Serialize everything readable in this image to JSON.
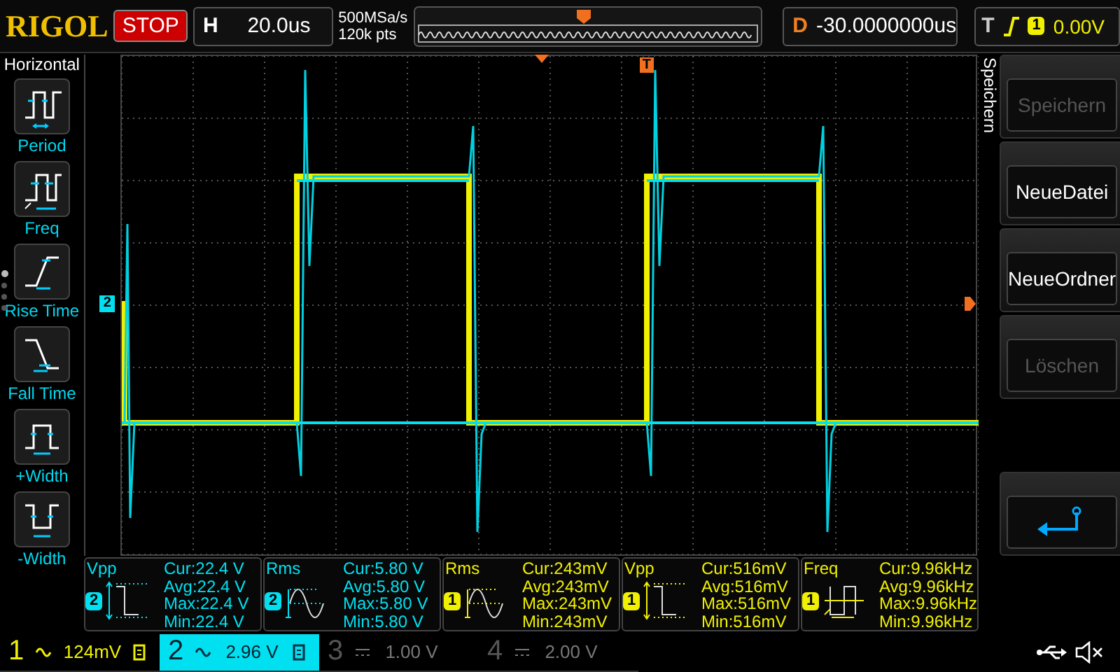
{
  "top_bar": {
    "brand": "RIGOL",
    "run_state": "STOP",
    "horizontal": {
      "label": "H",
      "value": "20.0us"
    },
    "sample_rate": "500MSa/s",
    "points": "120k pts",
    "delay": {
      "label": "D",
      "value": "-30.0000000us"
    },
    "trigger": {
      "label": "T",
      "source": "1",
      "level": "0.00V"
    }
  },
  "left_menu": {
    "title": "Horizontal",
    "items": [
      {
        "label": "Period",
        "kind": "period"
      },
      {
        "label": "Freq",
        "kind": "freq"
      },
      {
        "label": "Rise Time",
        "kind": "rise"
      },
      {
        "label": "Fall Time",
        "kind": "fall"
      },
      {
        "label": "+Width",
        "kind": "pwidth"
      },
      {
        "label": "-Width",
        "kind": "nwidth"
      }
    ],
    "pages": [
      {
        "selected": true
      },
      {
        "selected": false
      },
      {
        "selected": false
      },
      {
        "selected": false
      }
    ]
  },
  "display": {
    "channel_marker": "2",
    "trigger_marker": "T"
  },
  "measurements": [
    {
      "name": "Vpp",
      "channel": "2",
      "kind": "pulse",
      "lines": [
        "Cur:22.4 V",
        "Avg:22.4 V",
        "Max:22.4 V",
        "Min:22.4 V"
      ]
    },
    {
      "name": "Rms",
      "channel": "2",
      "kind": "sine",
      "lines": [
        "Cur:5.80 V",
        "Avg:5.80 V",
        "Max:5.80 V",
        "Min:5.80 V"
      ]
    },
    {
      "name": "Rms",
      "channel": "1",
      "kind": "sine",
      "lines": [
        "Cur:243mV",
        "Avg:243mV",
        "Max:243mV",
        "Min:243mV"
      ]
    },
    {
      "name": "Vpp",
      "channel": "1",
      "kind": "pulse",
      "lines": [
        "Cur:516mV",
        "Avg:516mV",
        "Max:516mV",
        "Min:516mV"
      ]
    },
    {
      "name": "Freq",
      "channel": "1",
      "kind": "freq",
      "lines": [
        "Cur:9.96kHz",
        "Avg:9.96kHz",
        "Max:9.96kHz",
        "Min:9.96kHz"
      ]
    }
  ],
  "channels": [
    {
      "number": "1",
      "kind": "ac",
      "scale": "124mV",
      "on": true,
      "selected": false
    },
    {
      "number": "2",
      "kind": "ac",
      "scale": "2.96 V",
      "on": true,
      "selected": true
    },
    {
      "number": "3",
      "kind": "dc",
      "scale": "1.00 V",
      "on": false,
      "selected": false
    },
    {
      "number": "4",
      "kind": "dc",
      "scale": "2.00 V",
      "on": false,
      "selected": false
    }
  ],
  "right_menu": {
    "title": "Speichern",
    "buttons": [
      {
        "label": "Speichern",
        "disabled": true
      },
      {
        "label": "NeueDatei",
        "disabled": false
      },
      {
        "label": "NeueOrdner",
        "disabled": false
      },
      {
        "label": "Löschen",
        "disabled": true
      }
    ]
  }
}
